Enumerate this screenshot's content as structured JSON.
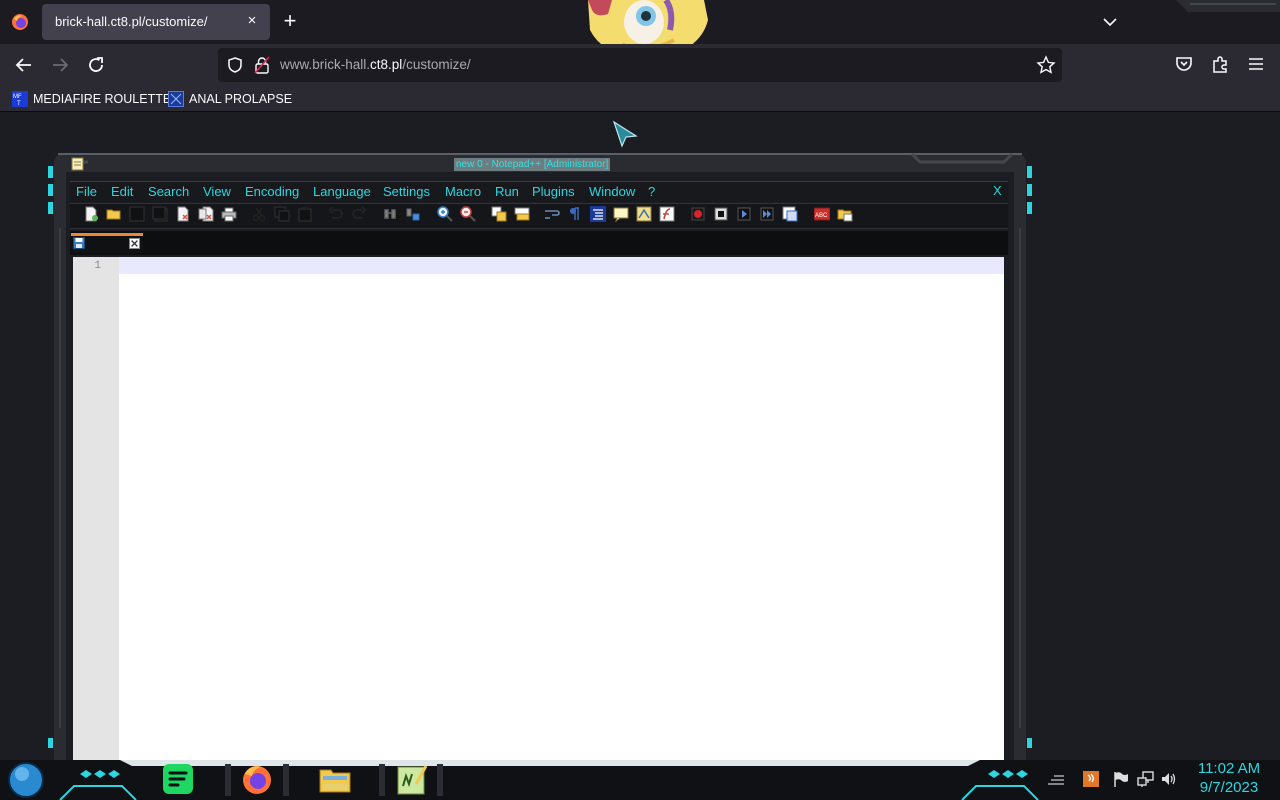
{
  "browser": {
    "tab_title": "brick-hall.ct8.pl/customize/",
    "tab_close": "×",
    "new_tab": "+",
    "url_prefix": "www.brick-hall.",
    "url_host": "ct8.pl",
    "url_path": "/customize/",
    "bookmarks": [
      {
        "label": "MEDIAFIRE ROULETTER",
        "icon": "mediafire-icon"
      },
      {
        "label": "ANAL PROLAPSE",
        "icon": "bookmark-icon"
      }
    ]
  },
  "npp": {
    "title": "new  0 - Notepad++ [Administrator]",
    "menu": [
      "File",
      "Edit",
      "Search",
      "View",
      "Encoding",
      "Language",
      "Settings",
      "Macro",
      "Run",
      "Plugins",
      "Window",
      "?"
    ],
    "menu_close": "X",
    "line_number": "1",
    "accent_color": "#2cd6e0"
  },
  "taskbar": {
    "time": "11:02 AM",
    "date": "9/7/2023",
    "apps": [
      "spotify-icon",
      "firefox-icon",
      "file-explorer-icon",
      "notepad-plus-plus-icon"
    ]
  }
}
